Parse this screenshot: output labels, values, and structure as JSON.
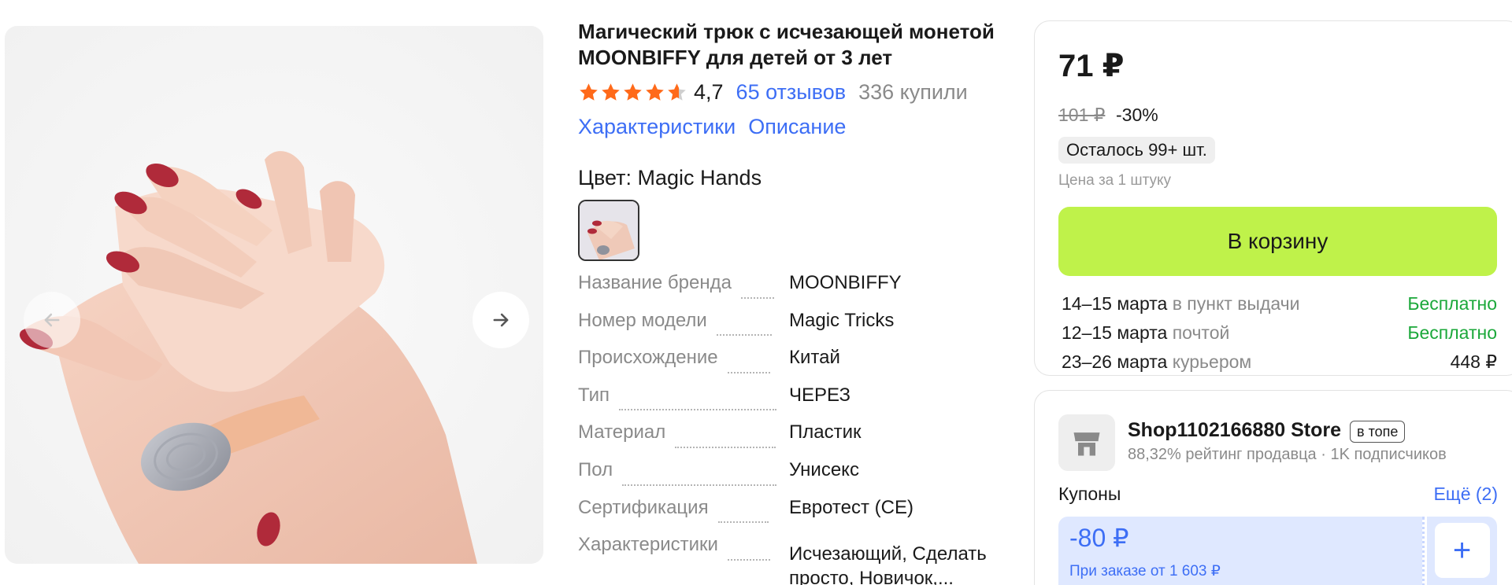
{
  "product": {
    "title": "Магический трюк с исчезающей монетой MOONBIFFY для детей от 3 лет",
    "rating": "4,7",
    "rating_value": 4.7,
    "reviews": "65 отзывов",
    "bought": "336 купили",
    "links": [
      "Характеристики",
      "Описание"
    ],
    "color_label": "Цвет: Magic Hands",
    "specs": [
      {
        "key": "Название бренда",
        "value": "MOONBIFFY"
      },
      {
        "key": "Номер модели",
        "value": "Magic Tricks"
      },
      {
        "key": "Происхождение",
        "value": "Китай"
      },
      {
        "key": "Тип",
        "value": "ЧЕРЕЗ"
      },
      {
        "key": "Материал",
        "value": "Пластик"
      },
      {
        "key": "Пол",
        "value": "Унисекс"
      },
      {
        "key": "Сертификация",
        "value": "Евротест (CE)"
      },
      {
        "key": "Характеристики",
        "value": "Исчезающий, Сделать просто, Новичок,..."
      }
    ]
  },
  "buy": {
    "price": "71 ₽",
    "old_price": "101 ₽",
    "discount": "-30%",
    "stock": "Осталось 99+ шт.",
    "unit_price": "Цена за 1 штуку",
    "cart_button": "В корзину",
    "delivery": [
      {
        "date": "14–15 марта",
        "how": "в пункт выдачи",
        "price": "Бесплатно",
        "free": true
      },
      {
        "date": "12–15 марта",
        "how": "почтой",
        "price": "Бесплатно",
        "free": true
      },
      {
        "date": "23–26 марта",
        "how": "курьером",
        "price": "448 ₽",
        "free": false
      }
    ],
    "colors": {
      "cart": "#bff24a",
      "free": "#1ba83a",
      "link": "#3d6ef5"
    }
  },
  "seller": {
    "name": "Shop1102166880 Store",
    "badge": "в топе",
    "meta": "88,32% рейтинг продавца · 1K подписчиков",
    "coupons_label": "Купоны",
    "coupons_more": "Ещё (2)",
    "coupon_amount": "-80 ₽",
    "coupon_condition": "При заказе от 1 603 ₽"
  }
}
